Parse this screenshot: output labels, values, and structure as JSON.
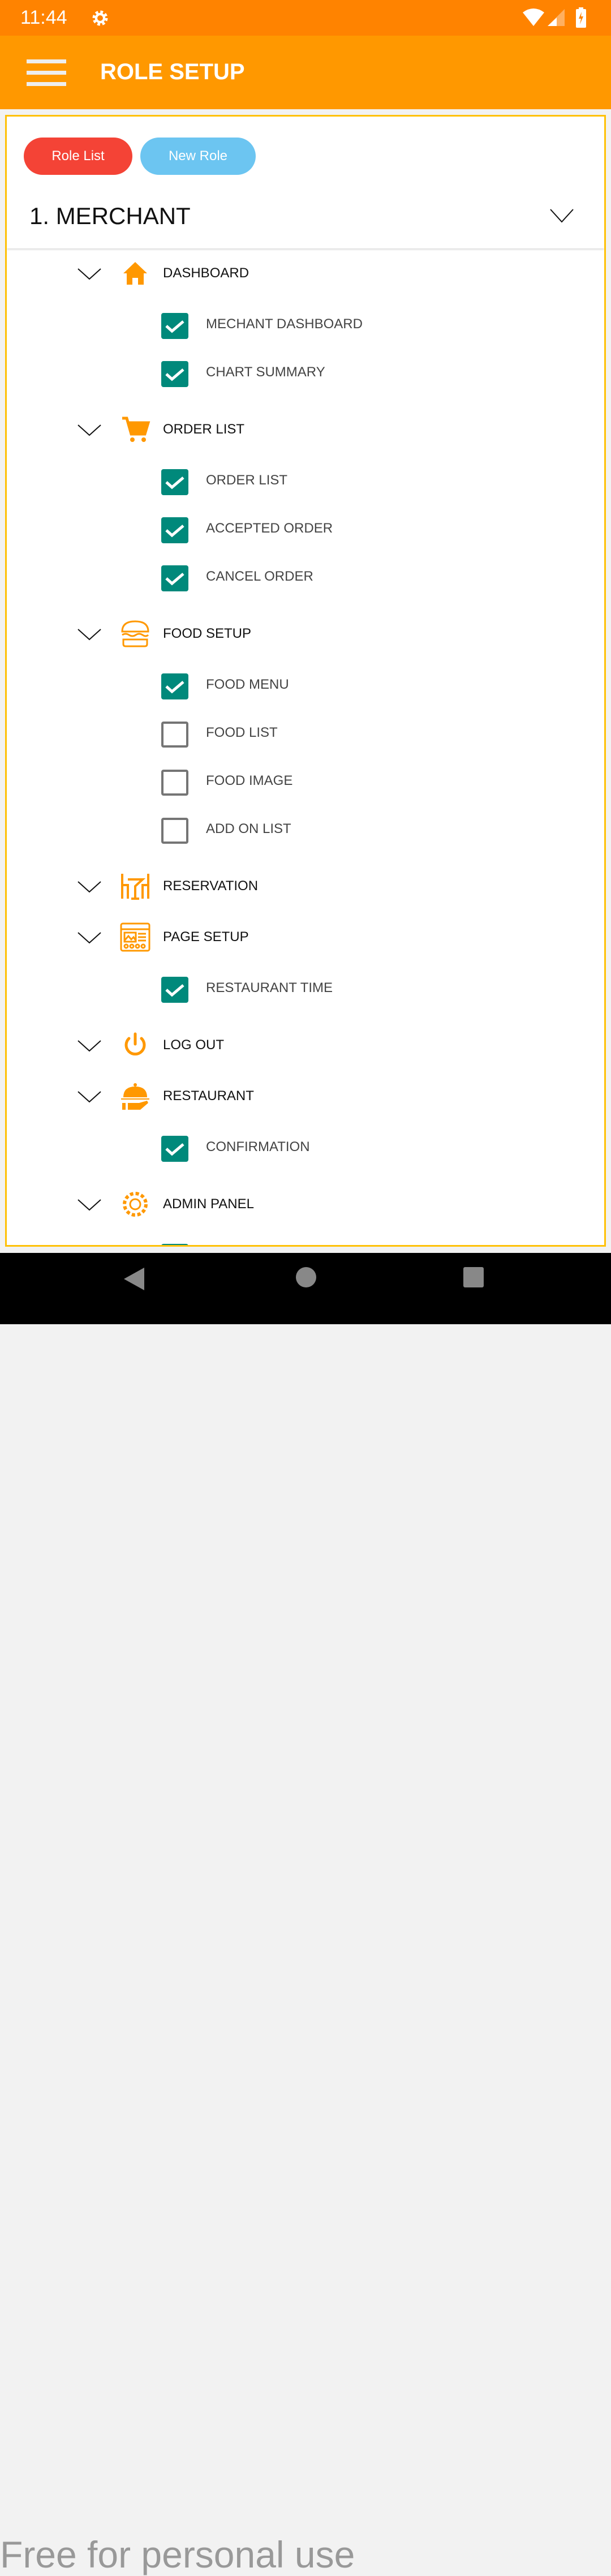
{
  "status_bar": {
    "time": "11:44"
  },
  "app_bar": {
    "title": "ROLE SETUP"
  },
  "buttons": {
    "role_list": "Role List",
    "new_role": "New Role"
  },
  "role": {
    "label": "1. MERCHANT"
  },
  "colors": {
    "accent": "#ff9800",
    "check": "#00897b",
    "role_list": "#f44336",
    "new_role": "#6cc5f1"
  },
  "groups": [
    {
      "label": "DASHBOARD",
      "icon": "home-icon",
      "items": [
        {
          "label": "MECHANT DASHBOARD",
          "checked": true
        },
        {
          "label": "CHART SUMMARY",
          "checked": true
        }
      ]
    },
    {
      "label": "ORDER LIST",
      "icon": "cart-icon",
      "items": [
        {
          "label": "ORDER LIST",
          "checked": true
        },
        {
          "label": "ACCEPTED ORDER",
          "checked": true
        },
        {
          "label": "CANCEL ORDER",
          "checked": true
        }
      ]
    },
    {
      "label": "FOOD SETUP",
      "icon": "burger-icon",
      "items": [
        {
          "label": "FOOD MENU",
          "checked": true
        },
        {
          "label": "FOOD LIST",
          "checked": false
        },
        {
          "label": "FOOD IMAGE",
          "checked": false
        },
        {
          "label": "ADD ON LIST",
          "checked": false
        }
      ]
    },
    {
      "label": "RESERVATION",
      "icon": "table-chairs-icon",
      "items": []
    },
    {
      "label": "PAGE SETUP",
      "icon": "webpage-icon",
      "items": [
        {
          "label": "RESTAURANT TIME",
          "checked": true
        }
      ]
    },
    {
      "label": "LOG OUT",
      "icon": "power-icon",
      "items": []
    },
    {
      "label": "RESTAURANT",
      "icon": "cloche-icon",
      "items": [
        {
          "label": "CONFIRMATION",
          "checked": true
        }
      ]
    },
    {
      "label": "ADMIN PANEL",
      "icon": "gear-icon",
      "items": [
        {
          "label": "",
          "checked": true
        }
      ]
    }
  ],
  "watermark": "Free for personal use"
}
